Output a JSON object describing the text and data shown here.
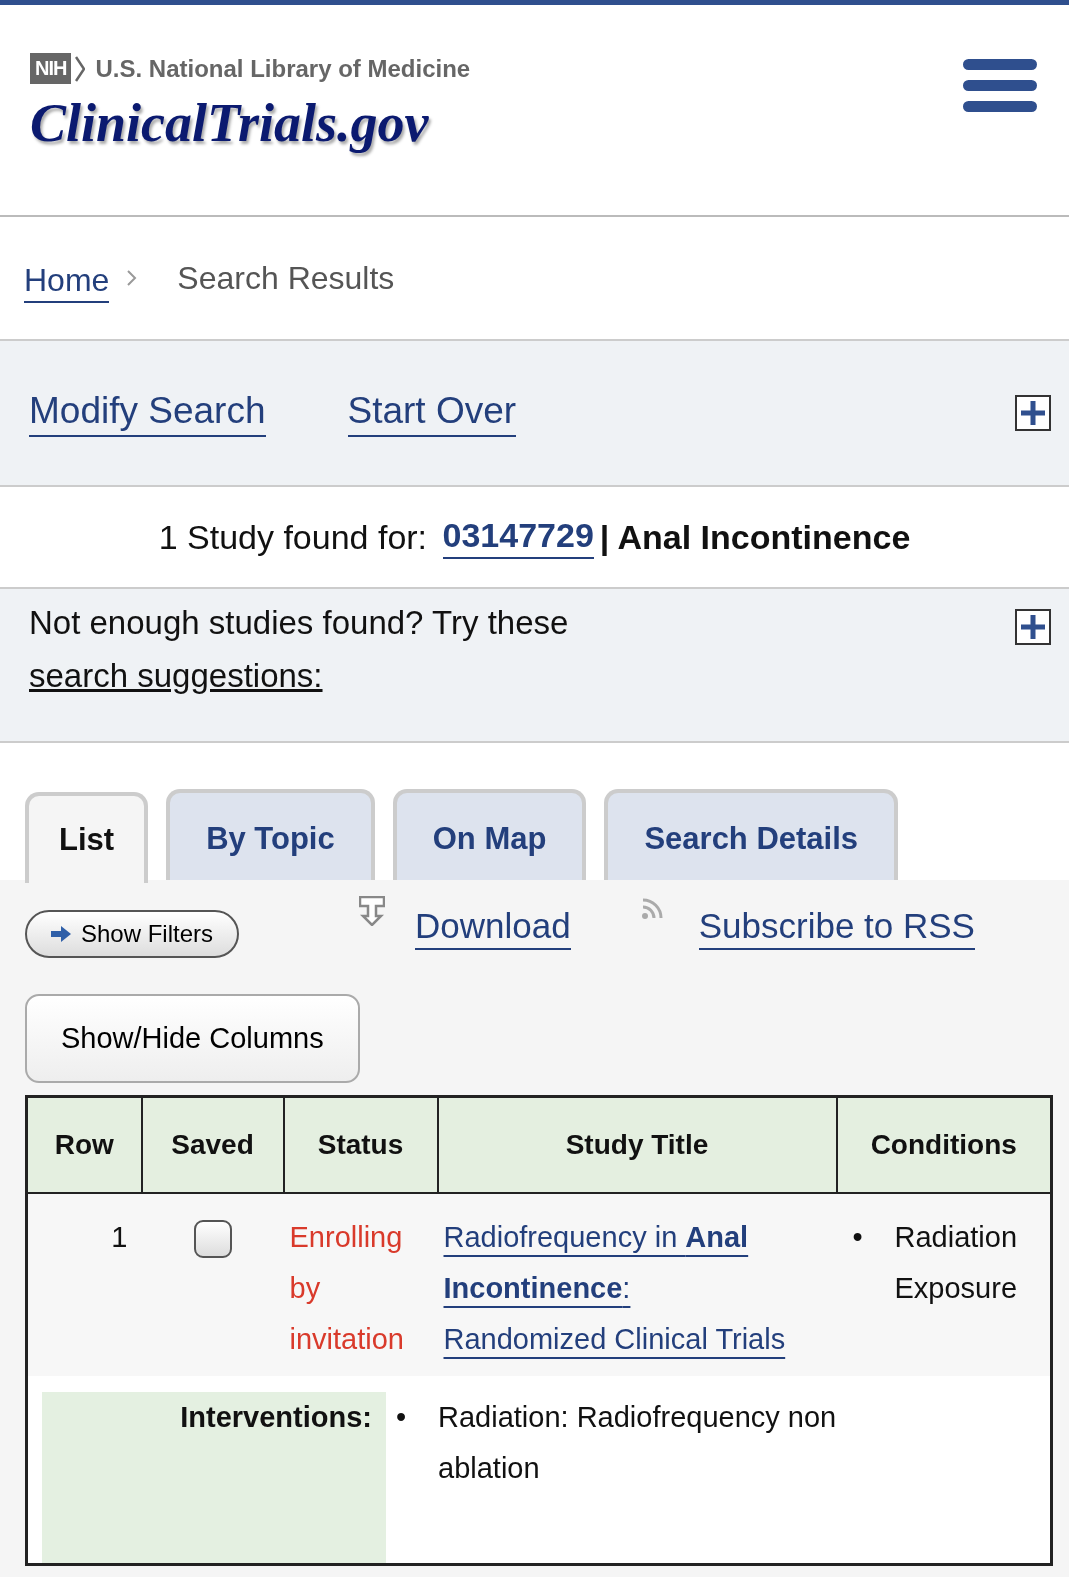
{
  "header": {
    "agency_badge": "NIH",
    "agency": "U.S. National Library of Medicine",
    "site_title": "ClinicalTrials.gov"
  },
  "breadcrumb": [
    {
      "label": "Home",
      "kind": "link"
    },
    {
      "label": "Search Results",
      "kind": "current"
    }
  ],
  "actions": [
    "Modify Search",
    "Start Over"
  ],
  "summary": {
    "prefix": "1 Study found for:",
    "query_id": "03147729",
    "query_terms": "| Anal Incontinence"
  },
  "suggestions": {
    "text": "Not enough studies found? Try these",
    "link": "search suggestions:"
  },
  "tabs": [
    {
      "label": "List",
      "selected": true
    },
    {
      "label": "By Topic",
      "selected": false
    },
    {
      "label": "On Map",
      "selected": false
    },
    {
      "label": "Search Details",
      "selected": false
    }
  ],
  "toolbar": {
    "filters_button": "Show Filters",
    "download": "Download",
    "rss": "Subscribe to RSS",
    "columns_button": "Show/Hide Columns"
  },
  "table": {
    "bullet": "•",
    "columns": [
      "Row",
      "Saved",
      "Status",
      "Study Title",
      "Conditions"
    ],
    "rows": [
      {
        "row": "1",
        "saved": false,
        "status": "Enrolling by invitation",
        "title": "Radiofrequency in **Anal Incontinence**: Randomized Clinical Trials",
        "conditions": [
          "Radiation Exposure"
        ],
        "interventions_label": "Interventions:",
        "interventions": [
          "Radiation: Radiofrequency non ablation"
        ]
      }
    ]
  }
}
